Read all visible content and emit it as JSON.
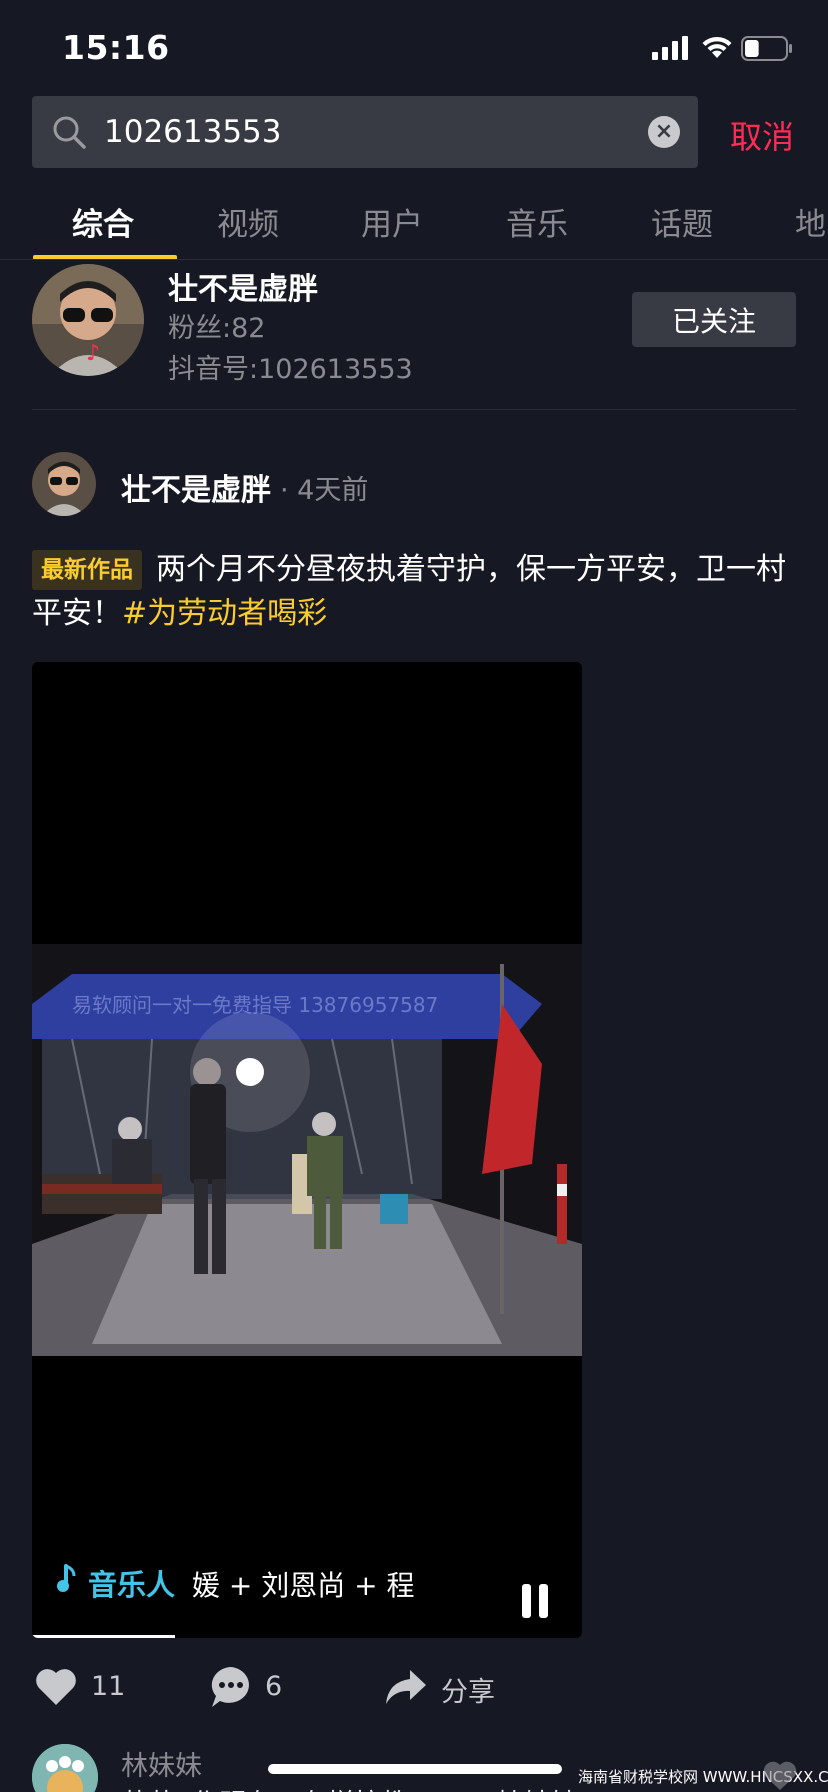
{
  "status_bar": {
    "time": "15:16",
    "signal_icon": "cellular-signal-icon",
    "wifi_icon": "wifi-icon",
    "battery_icon": "battery-icon",
    "battery_level": 0.35
  },
  "search": {
    "query": "102613553",
    "cancel_label": "取消",
    "search_icon": "search-icon",
    "clear_icon": "clear-icon"
  },
  "tabs": [
    {
      "label": "综合",
      "active": true
    },
    {
      "label": "视频"
    },
    {
      "label": "用户"
    },
    {
      "label": "音乐"
    },
    {
      "label": "话题"
    },
    {
      "label": "地"
    }
  ],
  "user_card": {
    "name": "壮不是虚胖",
    "fans": "粉丝:82",
    "douyin_id": "抖音号:102613553",
    "follow_label": "已关注"
  },
  "post": {
    "author": "壮不是虚胖",
    "time": "· 4天前",
    "badge": "最新作品",
    "caption": "两个月不分昼夜执着守护，保一方平安，卫一村平安！",
    "hashtag": "#为劳动者喝彩",
    "video_banner_text": "易软顾问一对一免费指导 13876957587",
    "music_label": "音乐人",
    "music_title": "媛 + 刘恩尚 + 程",
    "progress": 0.26
  },
  "actions": {
    "likes": "11",
    "comments": "6",
    "share_label": "分享"
  },
  "comment_preview": {
    "name": "林妹妹",
    "text": "萌萌 ·作明有下有样拉教可 ·一 ·桂姊姊"
  },
  "watermark": "海南省财税学校网 WWW.HNCSXX.COM",
  "colors": {
    "background": "#161823",
    "accent_red": "#fe2c55",
    "accent_yellow": "#facd2c",
    "music_cyan": "#41c4e8"
  }
}
